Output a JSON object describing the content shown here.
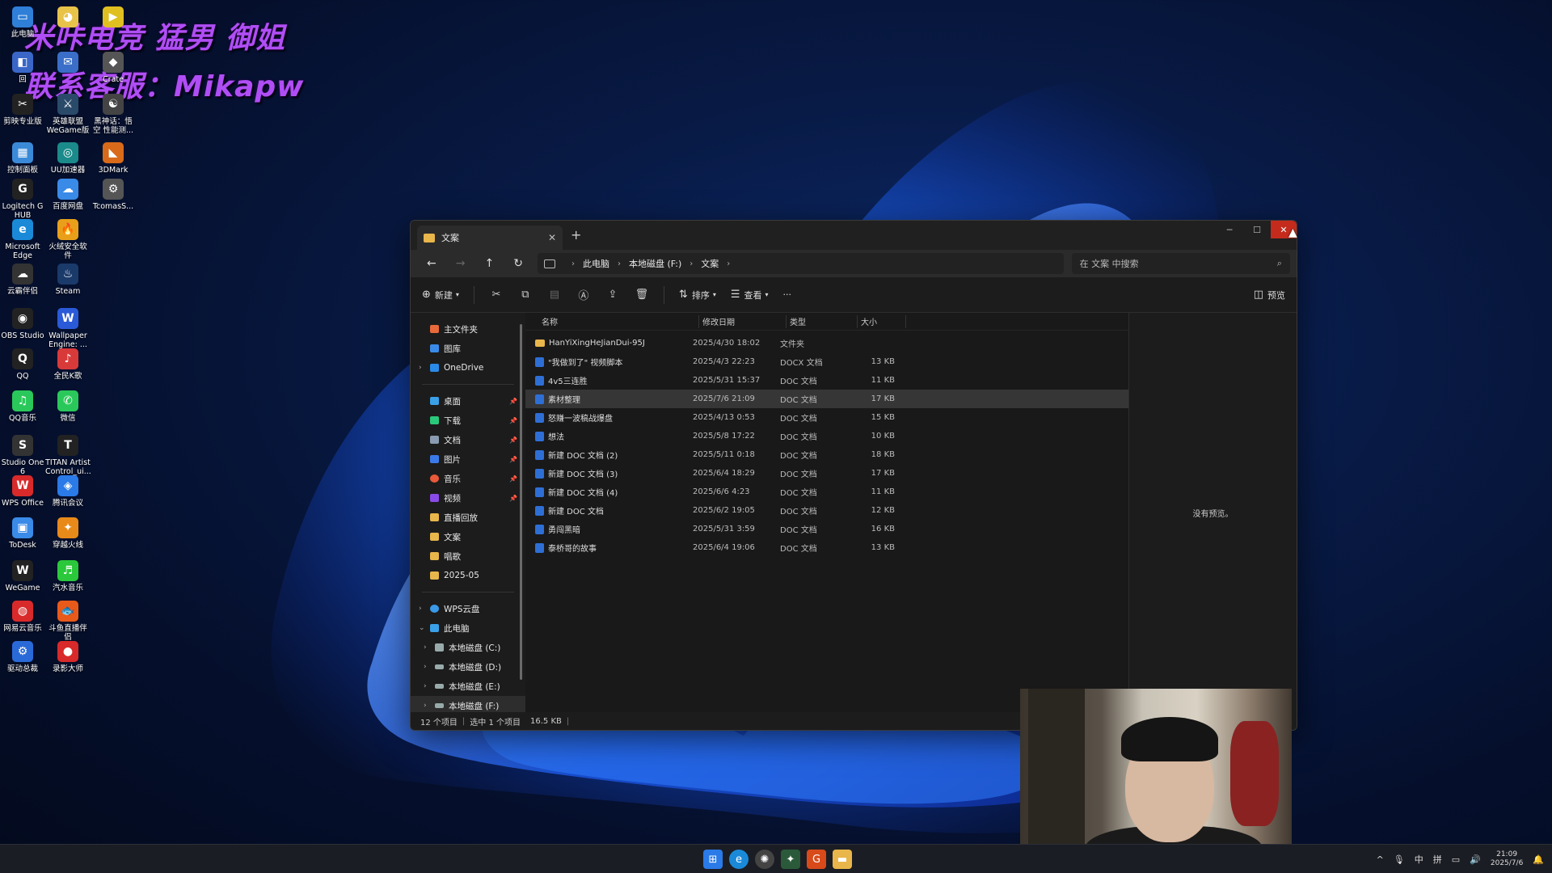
{
  "overlay": {
    "line1": "米咔电竞 猛男 御姐",
    "line2": "联系客服：Mikapw"
  },
  "desktop_icons": [
    {
      "label": "此电脑",
      "color": "#2f7fd8",
      "glyph": "▭"
    },
    {
      "label": "",
      "color": "#e8c34a",
      "glyph": "◕"
    },
    {
      "label": "",
      "color": "#e0c020",
      "glyph": "▶"
    },
    {
      "label": "回",
      "color": "#3a66c8",
      "glyph": "◧"
    },
    {
      "label": "",
      "color": "#3a6ec8",
      "glyph": "✉"
    },
    {
      "label": "Crate",
      "color": "#555",
      "glyph": "◆"
    },
    {
      "label": "剪映专业版",
      "color": "#222",
      "glyph": "✂"
    },
    {
      "label": "英雄联盟WeGame版",
      "color": "#2a4a6a",
      "glyph": "⚔"
    },
    {
      "label": "黑神话：悟空 性能测...",
      "color": "#444",
      "glyph": "☯"
    },
    {
      "label": "控制面板",
      "color": "#3a8ad8",
      "glyph": "▦"
    },
    {
      "label": "UU加速器",
      "color": "#1a8a8a",
      "glyph": "◎"
    },
    {
      "label": "3DMark",
      "color": "#d86a1a",
      "glyph": "◣"
    },
    {
      "label": "Logitech G HUB",
      "color": "#222",
      "glyph": "G"
    },
    {
      "label": "百度网盘",
      "color": "#3a8ae8",
      "glyph": "☁"
    },
    {
      "label": "TcomasS...",
      "color": "#555",
      "glyph": "⚙"
    },
    {
      "label": "Microsoft Edge",
      "color": "#1a8ad8",
      "glyph": "e"
    },
    {
      "label": "火绒安全软件",
      "color": "#e8a01a",
      "glyph": "🔥"
    },
    {
      "label": "云霸伴侣",
      "color": "#333",
      "glyph": "☁"
    },
    {
      "label": "Steam",
      "color": "#1a3a6a",
      "glyph": "♨"
    },
    {
      "label": "OBS Studio",
      "color": "#222",
      "glyph": "◉"
    },
    {
      "label": "Wallpaper Engine: ...",
      "color": "#2a5ad8",
      "glyph": "W"
    },
    {
      "label": "QQ",
      "color": "#222",
      "glyph": "Q"
    },
    {
      "label": "全民K歌",
      "color": "#d83a3a",
      "glyph": "♪"
    },
    {
      "label": "QQ音乐",
      "color": "#2ac85a",
      "glyph": "♫"
    },
    {
      "label": "微信",
      "color": "#2ac85a",
      "glyph": "✆"
    },
    {
      "label": "Studio One 6",
      "color": "#333",
      "glyph": "S"
    },
    {
      "label": "TITAN Artist Control_ui...",
      "color": "#222",
      "glyph": "T"
    },
    {
      "label": "WPS Office",
      "color": "#d82a2a",
      "glyph": "W"
    },
    {
      "label": "腾讯会议",
      "color": "#2a7ae8",
      "glyph": "◈"
    },
    {
      "label": "ToDesk",
      "color": "#3a8ae8",
      "glyph": "▣"
    },
    {
      "label": "穿越火线",
      "color": "#e88a1a",
      "glyph": "✦"
    },
    {
      "label": "WeGame",
      "color": "#222",
      "glyph": "W"
    },
    {
      "label": "汽水音乐",
      "color": "#2ac83a",
      "glyph": "♬"
    },
    {
      "label": "网易云音乐",
      "color": "#d82a2a",
      "glyph": "◍"
    },
    {
      "label": "斗鱼直播伴侣",
      "color": "#e85a1a",
      "glyph": "🐟"
    },
    {
      "label": "驱动总裁",
      "color": "#2a6ad8",
      "glyph": "⚙"
    },
    {
      "label": "录影大师",
      "color": "#d82a2a",
      "glyph": "●"
    }
  ],
  "explorer": {
    "tab_title": "文案",
    "new_tab": "+",
    "breadcrumb": [
      "此电脑",
      "本地磁盘 (F:)",
      "文案"
    ],
    "search_placeholder": "在 文案 中搜索",
    "commands": {
      "new": "新建",
      "sort": "排序",
      "view": "查看",
      "more": "···",
      "preview": "预览"
    },
    "nav": {
      "home": "主文件夹",
      "gallery": "图库",
      "onedrive": "OneDrive",
      "desktop": "桌面",
      "downloads": "下载",
      "documents": "文档",
      "pictures": "图片",
      "music": "音乐",
      "videos": "视频",
      "recordings": "直播回放",
      "wenan": "文案",
      "songs": "唱歌",
      "month": "2025-05",
      "wps": "WPS云盘",
      "thispc": "此电脑",
      "drive_c": "本地磁盘 (C:)",
      "drive_d": "本地磁盘 (D:)",
      "drive_e": "本地磁盘 (E:)",
      "drive_f": "本地磁盘 (F:)"
    },
    "columns": {
      "name": "名称",
      "modified": "修改日期",
      "type": "类型",
      "size": "大小"
    },
    "files": [
      {
        "name": "HanYiXingHeJianDui-95J",
        "date": "2025/4/30 18:02",
        "type": "文件夹",
        "size": "",
        "kind": "folder"
      },
      {
        "name": "\"我做到了\" 视频脚本",
        "date": "2025/4/3 22:23",
        "type": "DOCX 文档",
        "size": "13 KB",
        "kind": "doc"
      },
      {
        "name": "4v5三连胜",
        "date": "2025/5/31 15:37",
        "type": "DOC 文档",
        "size": "11 KB",
        "kind": "doc"
      },
      {
        "name": "素材整理",
        "date": "2025/7/6 21:09",
        "type": "DOC 文档",
        "size": "17 KB",
        "kind": "doc"
      },
      {
        "name": "怒赚一波稿战爆盘",
        "date": "2025/4/13 0:53",
        "type": "DOC 文档",
        "size": "15 KB",
        "kind": "doc"
      },
      {
        "name": "想法",
        "date": "2025/5/8 17:22",
        "type": "DOC 文档",
        "size": "10 KB",
        "kind": "doc"
      },
      {
        "name": "新建 DOC 文档 (2)",
        "date": "2025/5/11 0:18",
        "type": "DOC 文档",
        "size": "18 KB",
        "kind": "doc"
      },
      {
        "name": "新建 DOC 文档 (3)",
        "date": "2025/6/4 18:29",
        "type": "DOC 文档",
        "size": "17 KB",
        "kind": "doc"
      },
      {
        "name": "新建 DOC 文档 (4)",
        "date": "2025/6/6 4:23",
        "type": "DOC 文档",
        "size": "11 KB",
        "kind": "doc"
      },
      {
        "name": "新建 DOC 文档",
        "date": "2025/6/2 19:05",
        "type": "DOC 文档",
        "size": "12 KB",
        "kind": "doc"
      },
      {
        "name": "勇闯黑暗",
        "date": "2025/5/31 3:59",
        "type": "DOC 文档",
        "size": "16 KB",
        "kind": "doc"
      },
      {
        "name": "泰桥哥的故事",
        "date": "2025/6/4 19:06",
        "type": "DOC 文档",
        "size": "13 KB",
        "kind": "doc"
      }
    ],
    "selected_index": 3,
    "preview_text": "没有预览。",
    "status": {
      "count": "12 个项目",
      "selected": "选中 1 个项目",
      "size": "16.5 KB"
    }
  },
  "tray": {
    "caret": "^",
    "mic": "🎙",
    "ime": "中",
    "ime2": "拼",
    "time": "21:09",
    "date": "2025/7/6"
  }
}
